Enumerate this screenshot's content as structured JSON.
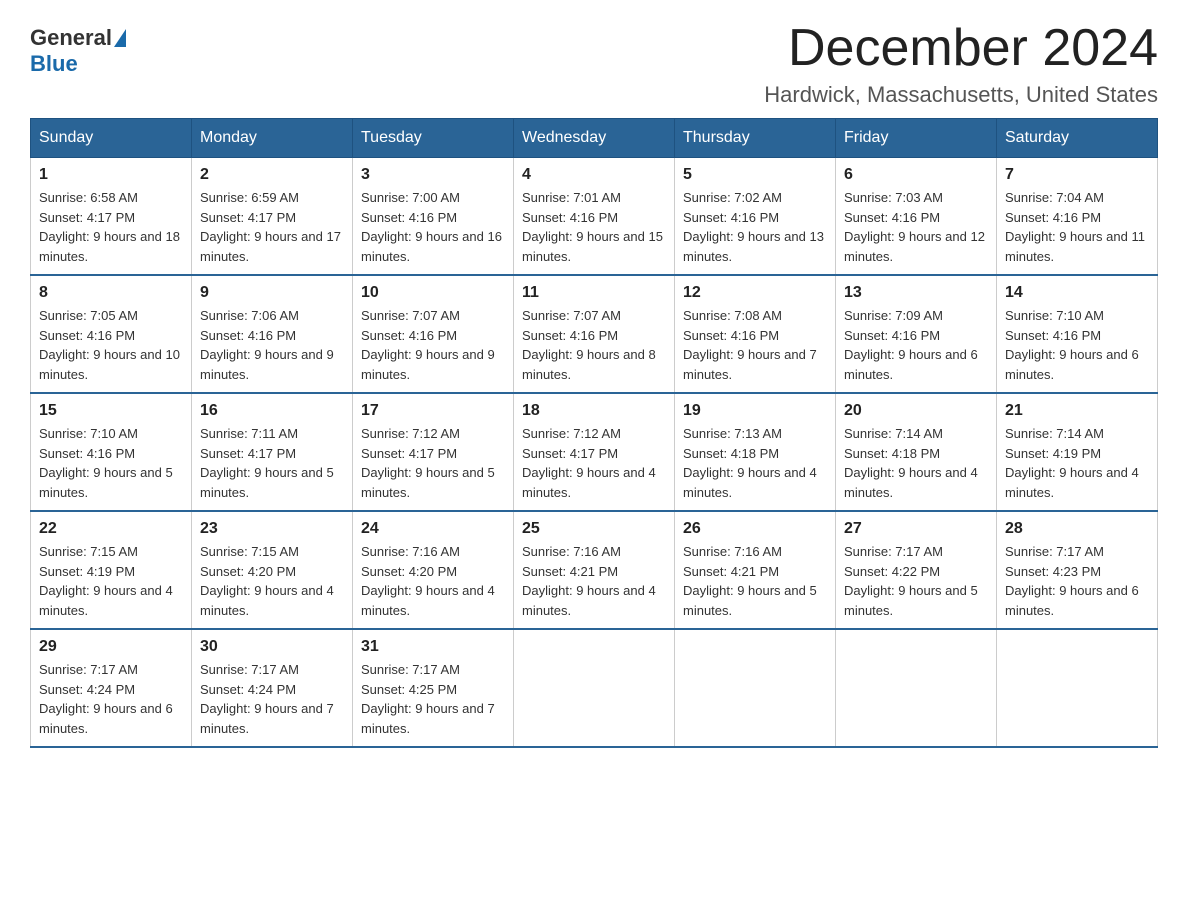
{
  "header": {
    "logo_general": "General",
    "logo_blue": "Blue",
    "month_title": "December 2024",
    "location": "Hardwick, Massachusetts, United States"
  },
  "days_of_week": [
    "Sunday",
    "Monday",
    "Tuesday",
    "Wednesday",
    "Thursday",
    "Friday",
    "Saturday"
  ],
  "weeks": [
    [
      {
        "day": "1",
        "sunrise": "6:58 AM",
        "sunset": "4:17 PM",
        "daylight": "9 hours and 18 minutes."
      },
      {
        "day": "2",
        "sunrise": "6:59 AM",
        "sunset": "4:17 PM",
        "daylight": "9 hours and 17 minutes."
      },
      {
        "day": "3",
        "sunrise": "7:00 AM",
        "sunset": "4:16 PM",
        "daylight": "9 hours and 16 minutes."
      },
      {
        "day": "4",
        "sunrise": "7:01 AM",
        "sunset": "4:16 PM",
        "daylight": "9 hours and 15 minutes."
      },
      {
        "day": "5",
        "sunrise": "7:02 AM",
        "sunset": "4:16 PM",
        "daylight": "9 hours and 13 minutes."
      },
      {
        "day": "6",
        "sunrise": "7:03 AM",
        "sunset": "4:16 PM",
        "daylight": "9 hours and 12 minutes."
      },
      {
        "day": "7",
        "sunrise": "7:04 AM",
        "sunset": "4:16 PM",
        "daylight": "9 hours and 11 minutes."
      }
    ],
    [
      {
        "day": "8",
        "sunrise": "7:05 AM",
        "sunset": "4:16 PM",
        "daylight": "9 hours and 10 minutes."
      },
      {
        "day": "9",
        "sunrise": "7:06 AM",
        "sunset": "4:16 PM",
        "daylight": "9 hours and 9 minutes."
      },
      {
        "day": "10",
        "sunrise": "7:07 AM",
        "sunset": "4:16 PM",
        "daylight": "9 hours and 9 minutes."
      },
      {
        "day": "11",
        "sunrise": "7:07 AM",
        "sunset": "4:16 PM",
        "daylight": "9 hours and 8 minutes."
      },
      {
        "day": "12",
        "sunrise": "7:08 AM",
        "sunset": "4:16 PM",
        "daylight": "9 hours and 7 minutes."
      },
      {
        "day": "13",
        "sunrise": "7:09 AM",
        "sunset": "4:16 PM",
        "daylight": "9 hours and 6 minutes."
      },
      {
        "day": "14",
        "sunrise": "7:10 AM",
        "sunset": "4:16 PM",
        "daylight": "9 hours and 6 minutes."
      }
    ],
    [
      {
        "day": "15",
        "sunrise": "7:10 AM",
        "sunset": "4:16 PM",
        "daylight": "9 hours and 5 minutes."
      },
      {
        "day": "16",
        "sunrise": "7:11 AM",
        "sunset": "4:17 PM",
        "daylight": "9 hours and 5 minutes."
      },
      {
        "day": "17",
        "sunrise": "7:12 AM",
        "sunset": "4:17 PM",
        "daylight": "9 hours and 5 minutes."
      },
      {
        "day": "18",
        "sunrise": "7:12 AM",
        "sunset": "4:17 PM",
        "daylight": "9 hours and 4 minutes."
      },
      {
        "day": "19",
        "sunrise": "7:13 AM",
        "sunset": "4:18 PM",
        "daylight": "9 hours and 4 minutes."
      },
      {
        "day": "20",
        "sunrise": "7:14 AM",
        "sunset": "4:18 PM",
        "daylight": "9 hours and 4 minutes."
      },
      {
        "day": "21",
        "sunrise": "7:14 AM",
        "sunset": "4:19 PM",
        "daylight": "9 hours and 4 minutes."
      }
    ],
    [
      {
        "day": "22",
        "sunrise": "7:15 AM",
        "sunset": "4:19 PM",
        "daylight": "9 hours and 4 minutes."
      },
      {
        "day": "23",
        "sunrise": "7:15 AM",
        "sunset": "4:20 PM",
        "daylight": "9 hours and 4 minutes."
      },
      {
        "day": "24",
        "sunrise": "7:16 AM",
        "sunset": "4:20 PM",
        "daylight": "9 hours and 4 minutes."
      },
      {
        "day": "25",
        "sunrise": "7:16 AM",
        "sunset": "4:21 PM",
        "daylight": "9 hours and 4 minutes."
      },
      {
        "day": "26",
        "sunrise": "7:16 AM",
        "sunset": "4:21 PM",
        "daylight": "9 hours and 5 minutes."
      },
      {
        "day": "27",
        "sunrise": "7:17 AM",
        "sunset": "4:22 PM",
        "daylight": "9 hours and 5 minutes."
      },
      {
        "day": "28",
        "sunrise": "7:17 AM",
        "sunset": "4:23 PM",
        "daylight": "9 hours and 6 minutes."
      }
    ],
    [
      {
        "day": "29",
        "sunrise": "7:17 AM",
        "sunset": "4:24 PM",
        "daylight": "9 hours and 6 minutes."
      },
      {
        "day": "30",
        "sunrise": "7:17 AM",
        "sunset": "4:24 PM",
        "daylight": "9 hours and 7 minutes."
      },
      {
        "day": "31",
        "sunrise": "7:17 AM",
        "sunset": "4:25 PM",
        "daylight": "9 hours and 7 minutes."
      },
      null,
      null,
      null,
      null
    ]
  ]
}
